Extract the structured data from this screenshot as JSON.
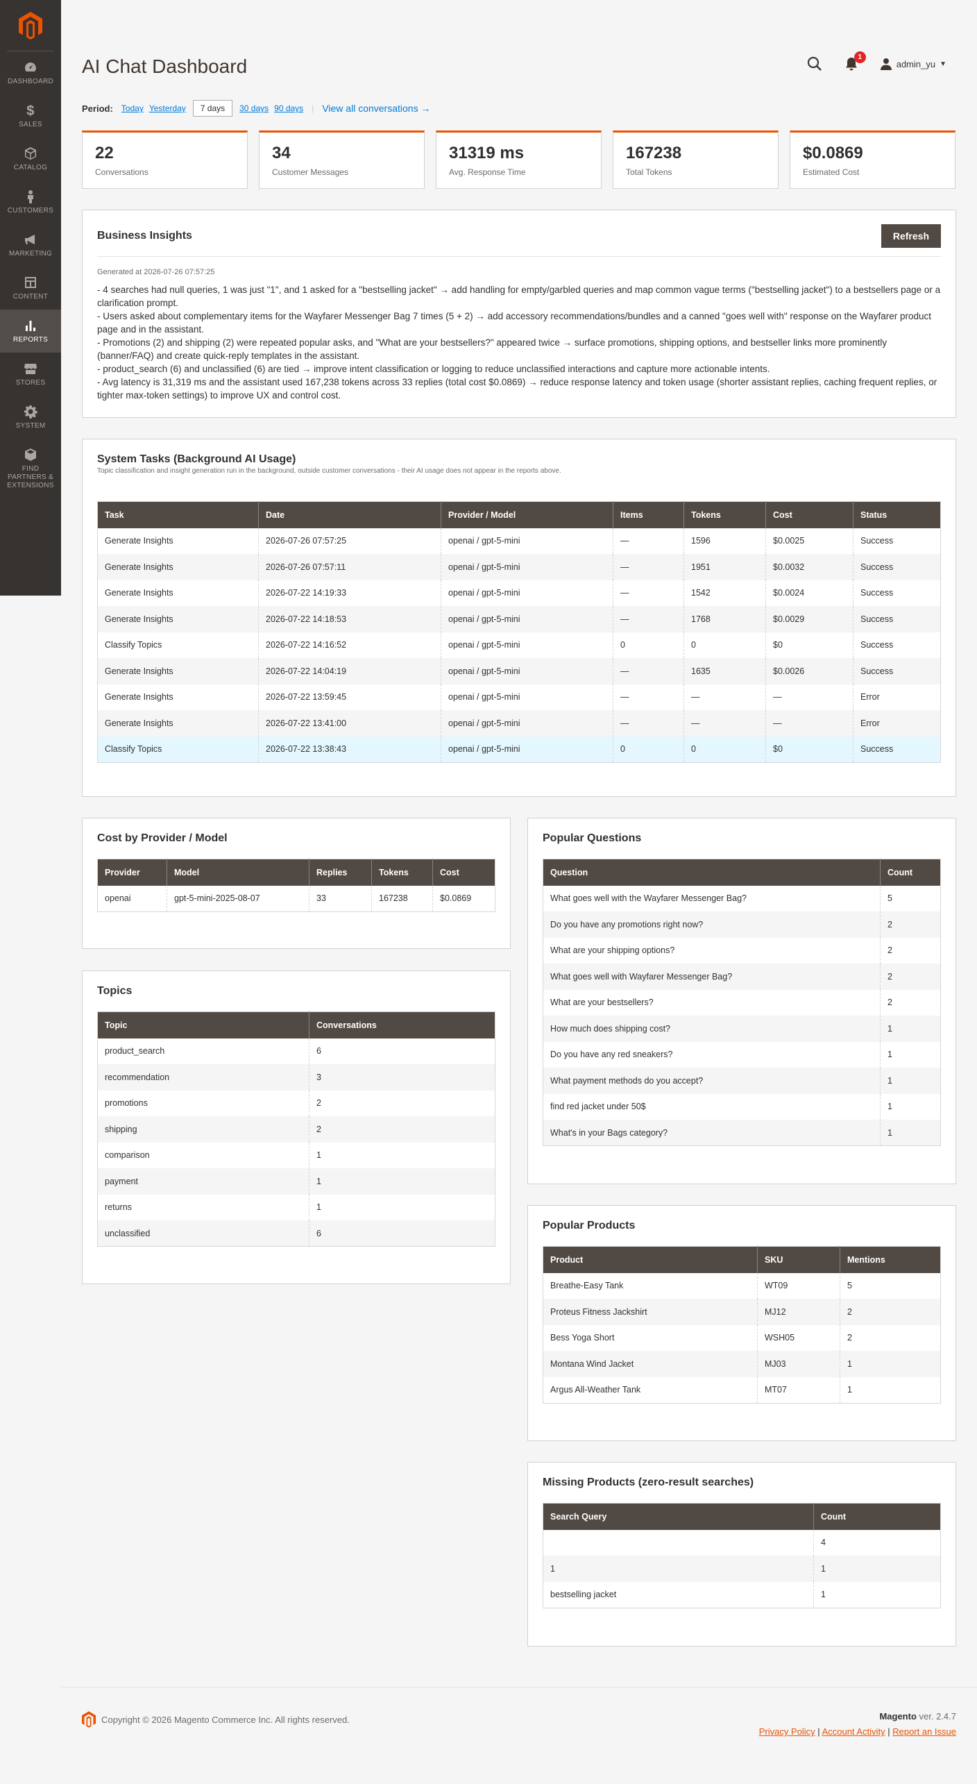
{
  "sidebar": {
    "items": [
      {
        "label": "Dashboard",
        "icon": "dashboard-icon"
      },
      {
        "label": "Sales",
        "icon": "dollar-icon"
      },
      {
        "label": "Catalog",
        "icon": "box-icon"
      },
      {
        "label": "Customers",
        "icon": "person-icon"
      },
      {
        "label": "Marketing",
        "icon": "megaphone-icon"
      },
      {
        "label": "Content",
        "icon": "layout-icon"
      },
      {
        "label": "Reports",
        "icon": "bar-chart-icon"
      },
      {
        "label": "Stores",
        "icon": "store-icon"
      },
      {
        "label": "System",
        "icon": "gear-icon"
      },
      {
        "label": "Find Partners & Extensions",
        "icon": "cubes-icon"
      }
    ]
  },
  "header": {
    "title": "AI Chat Dashboard",
    "notifications_count": "1",
    "user": "admin_yu"
  },
  "period": {
    "label": "Period:",
    "options": [
      "Today",
      "Yesterday",
      "7 days",
      "30 days",
      "90 days"
    ],
    "view_all": "View all conversations →"
  },
  "stats": [
    {
      "value": "22",
      "label": "Conversations"
    },
    {
      "value": "34",
      "label": "Customer Messages"
    },
    {
      "value": "31319 ms",
      "label": "Avg. Response Time"
    },
    {
      "value": "167238",
      "label": "Total Tokens"
    },
    {
      "value": "$0.0869",
      "label": "Estimated Cost"
    }
  ],
  "insights": {
    "title": "Business Insights",
    "refresh": "Refresh",
    "generated": "Generated at 2026-07-26 07:57:25",
    "lines": [
      "- 4 searches had null queries, 1 was just \"1\", and 1 asked for a \"bestselling jacket\" → add handling for empty/garbled queries and map common vague terms (\"bestselling jacket\") to a bestsellers page or a clarification prompt.",
      "- Users asked about complementary items for the Wayfarer Messenger Bag 7 times (5 + 2) → add accessory recommendations/bundles and a canned \"goes well with\" response on the Wayfarer product page and in the assistant.",
      "- Promotions (2) and shipping (2) were repeated popular asks, and \"What are your bestsellers?\" appeared twice → surface promotions, shipping options, and bestseller links more prominently (banner/FAQ) and create quick-reply templates in the assistant.",
      "- product_search (6) and unclassified (6) are tied → improve intent classification or logging to reduce unclassified interactions and capture more actionable intents.",
      "- Avg latency is 31,319 ms and the assistant used 167,238 tokens across 33 replies (total cost $0.0869) → reduce response latency and token usage (shorter assistant replies, caching frequent replies, or tighter max-token settings) to improve UX and control cost."
    ]
  },
  "system_tasks": {
    "title": "System Tasks (Background AI Usage)",
    "subtitle": "Topic classification and insight generation run in the background, outside customer conversations - their AI usage does not appear in the reports above.",
    "columns": [
      "Task",
      "Date",
      "Provider / Model",
      "Items",
      "Tokens",
      "Cost",
      "Status"
    ],
    "rows": [
      [
        "Generate Insights",
        "2026-07-26 07:57:25",
        "openai / gpt-5-mini",
        "—",
        "1596",
        "$0.0025",
        "Success"
      ],
      [
        "Generate Insights",
        "2026-07-26 07:57:11",
        "openai / gpt-5-mini",
        "—",
        "1951",
        "$0.0032",
        "Success"
      ],
      [
        "Generate Insights",
        "2026-07-22 14:19:33",
        "openai / gpt-5-mini",
        "—",
        "1542",
        "$0.0024",
        "Success"
      ],
      [
        "Generate Insights",
        "2026-07-22 14:18:53",
        "openai / gpt-5-mini",
        "—",
        "1768",
        "$0.0029",
        "Success"
      ],
      [
        "Classify Topics",
        "2026-07-22 14:16:52",
        "openai / gpt-5-mini",
        "0",
        "0",
        "$0",
        "Success"
      ],
      [
        "Generate Insights",
        "2026-07-22 14:04:19",
        "openai / gpt-5-mini",
        "—",
        "1635",
        "$0.0026",
        "Success"
      ],
      [
        "Generate Insights",
        "2026-07-22 13:59:45",
        "openai / gpt-5-mini",
        "—",
        "—",
        "—",
        "Error"
      ],
      [
        "Generate Insights",
        "2026-07-22 13:41:00",
        "openai / gpt-5-mini",
        "—",
        "—",
        "—",
        "Error"
      ],
      [
        "Classify Topics",
        "2026-07-22 13:38:43",
        "openai / gpt-5-mini",
        "0",
        "0",
        "$0",
        "Success"
      ]
    ]
  },
  "cost_by_provider": {
    "title": "Cost by Provider / Model",
    "columns": [
      "Provider",
      "Model",
      "Replies",
      "Tokens",
      "Cost"
    ],
    "rows": [
      [
        "openai",
        "gpt-5-mini-2025-08-07",
        "33",
        "167238",
        "$0.0869"
      ]
    ]
  },
  "topics": {
    "title": "Topics",
    "columns": [
      "Topic",
      "Conversations"
    ],
    "rows": [
      [
        "product_search",
        "6"
      ],
      [
        "recommendation",
        "3"
      ],
      [
        "promotions",
        "2"
      ],
      [
        "shipping",
        "2"
      ],
      [
        "comparison",
        "1"
      ],
      [
        "payment",
        "1"
      ],
      [
        "returns",
        "1"
      ],
      [
        "unclassified",
        "6"
      ]
    ]
  },
  "popular_questions": {
    "title": "Popular Questions",
    "columns": [
      "Question",
      "Count"
    ],
    "rows": [
      [
        "What goes well with the Wayfarer Messenger Bag?",
        "5"
      ],
      [
        "Do you have any promotions right now?",
        "2"
      ],
      [
        "What are your shipping options?",
        "2"
      ],
      [
        "What goes well with Wayfarer Messenger Bag?",
        "2"
      ],
      [
        "What are your bestsellers?",
        "2"
      ],
      [
        "How much does shipping cost?",
        "1"
      ],
      [
        "Do you have any red sneakers?",
        "1"
      ],
      [
        "What payment methods do you accept?",
        "1"
      ],
      [
        "find red jacket under 50$",
        "1"
      ],
      [
        "What's in your Bags category?",
        "1"
      ]
    ]
  },
  "popular_products": {
    "title": "Popular Products",
    "columns": [
      "Product",
      "SKU",
      "Mentions"
    ],
    "rows": [
      [
        "Breathe-Easy Tank",
        "WT09",
        "5"
      ],
      [
        "Proteus Fitness Jackshirt",
        "MJ12",
        "2"
      ],
      [
        "Bess Yoga Short",
        "WSH05",
        "2"
      ],
      [
        "Montana Wind Jacket",
        "MJ03",
        "1"
      ],
      [
        "Argus All-Weather Tank",
        "MT07",
        "1"
      ]
    ]
  },
  "missing_products": {
    "title": "Missing Products (zero-result searches)",
    "columns": [
      "Search Query",
      "Count"
    ],
    "rows": [
      [
        "",
        "4"
      ],
      [
        "1",
        "1"
      ],
      [
        "bestselling jacket",
        "1"
      ]
    ]
  },
  "footer": {
    "copyright": "Copyright © 2026 Magento Commerce Inc. All rights reserved.",
    "brand": "Magento",
    "version": " ver. 2.4.7",
    "links": [
      "Privacy Policy",
      "Account Activity",
      "Report an Issue"
    ]
  },
  "colors": {
    "accent": "#eb5202",
    "sidebar": "#373330",
    "table_header": "#514943",
    "link": "#007bdb"
  }
}
